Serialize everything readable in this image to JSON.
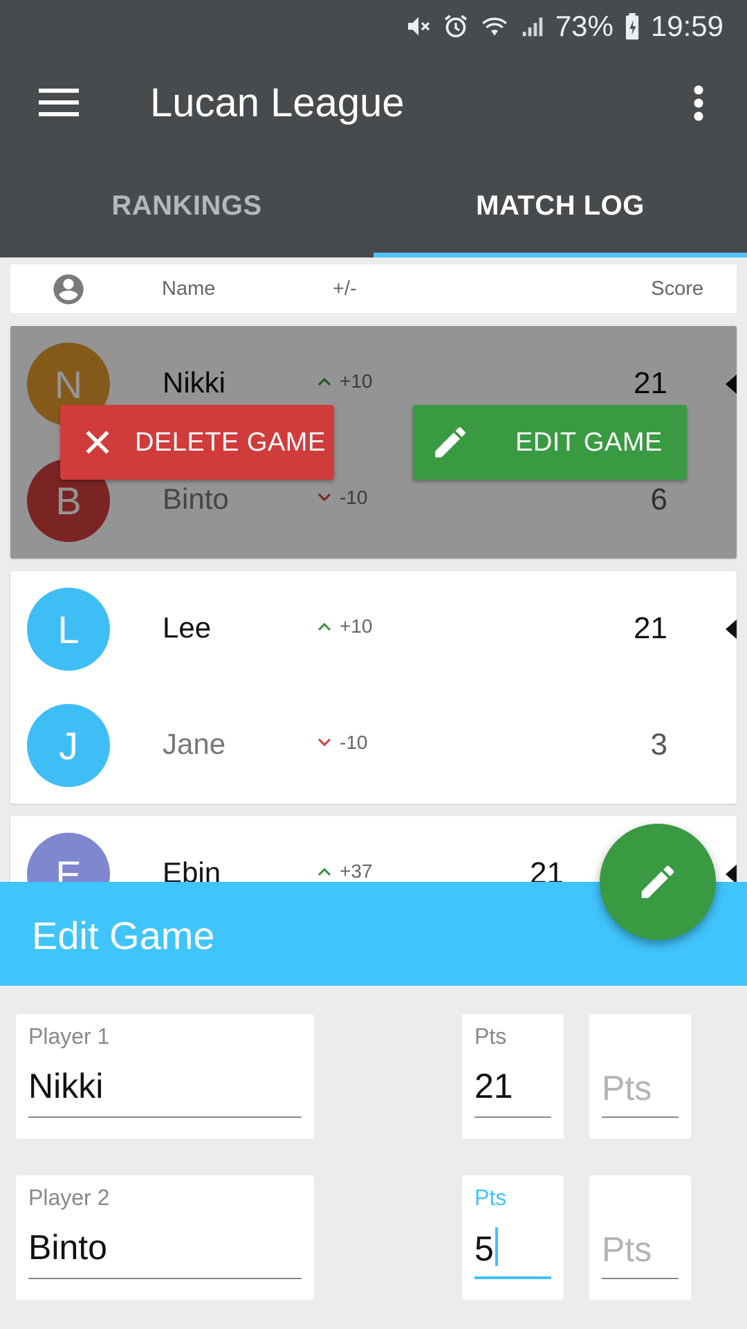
{
  "status_bar": {
    "battery": "73%",
    "time": "19:59"
  },
  "app": {
    "title": "Lucan League"
  },
  "tabs": [
    {
      "label": "RANKINGS",
      "active": false
    },
    {
      "label": "MATCH LOG",
      "active": true
    }
  ],
  "table_header": {
    "name": "Name",
    "plus_minus": "+/-",
    "score": "Score"
  },
  "games": [
    {
      "player1": {
        "initial": "N",
        "name": "Nikki",
        "delta": "+10",
        "score": "21",
        "color": "#e39b2f"
      },
      "player2": {
        "initial": "B",
        "name": "Binto",
        "delta": "-10",
        "score": "6",
        "color": "#d43f3f"
      }
    },
    {
      "player1": {
        "initial": "L",
        "name": "Lee",
        "delta": "+10",
        "score": "21",
        "color": "#3fbef5"
      },
      "player2": {
        "initial": "J",
        "name": "Jane",
        "delta": "-10",
        "score": "3",
        "color": "#3fbef5"
      }
    },
    {
      "player1": {
        "initial": "E",
        "name": "Ebin",
        "delta": "+37",
        "score": "21",
        "color": "#7f87cf"
      }
    }
  ],
  "actions": {
    "delete": "DELETE GAME",
    "edit": "EDIT GAME"
  },
  "colors": {
    "up": "#3a8f3a",
    "down": "#d03c3c",
    "accent": "#40c4fc",
    "fab": "#3a9a42"
  },
  "edit_game": {
    "title": "Edit Game",
    "player1": {
      "label": "Player 1",
      "value": "Nikki",
      "pts_label": "Pts",
      "pts_value": "21",
      "pts2_placeholder": "Pts"
    },
    "player2": {
      "label": "Player 2",
      "value": "Binto",
      "pts_label": "Pts",
      "pts_value": "5",
      "pts2_placeholder": "Pts"
    }
  }
}
